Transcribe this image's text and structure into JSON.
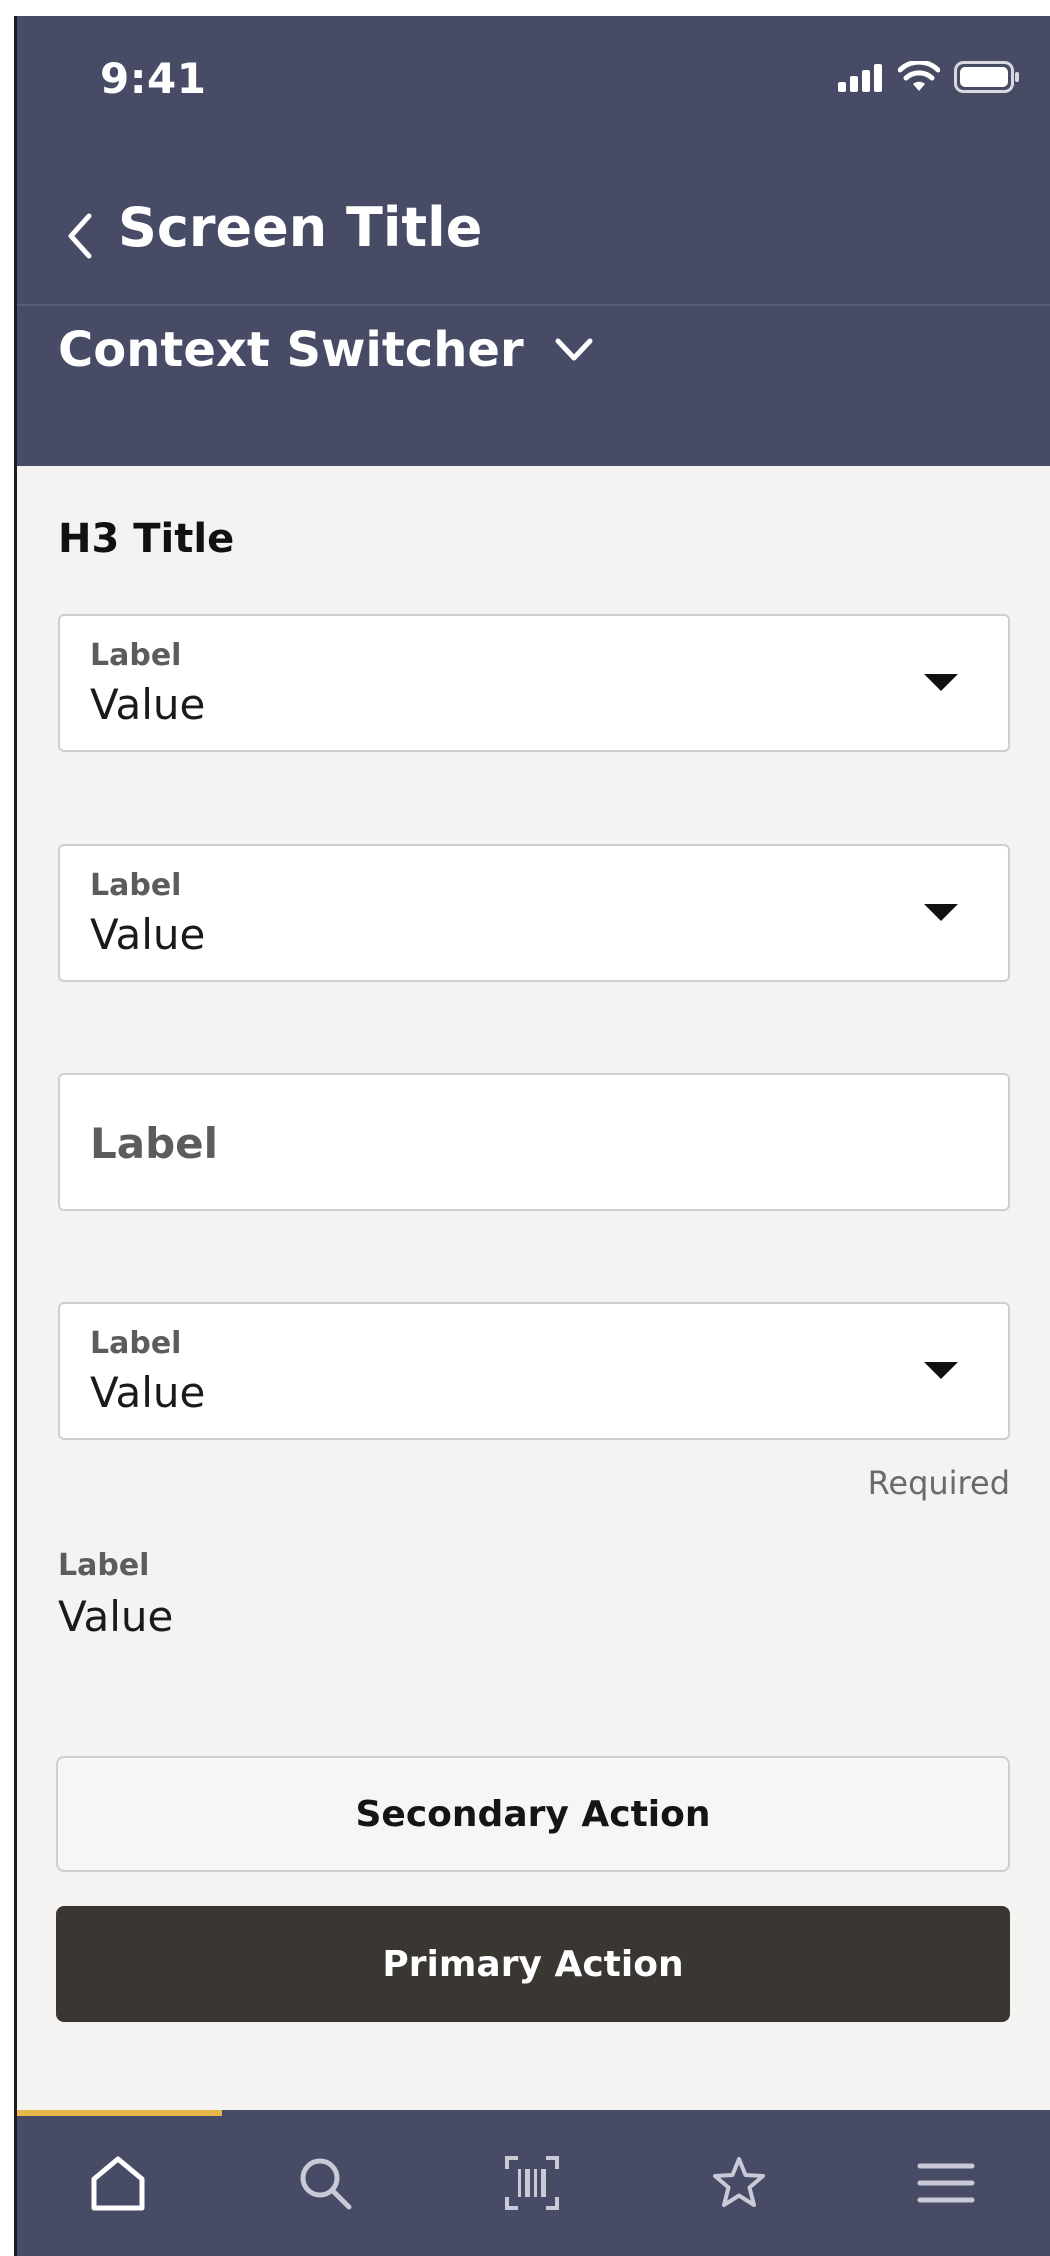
{
  "status_bar": {
    "time": "9:41"
  },
  "header": {
    "title": "Screen Title",
    "context_switcher": "Context Switcher"
  },
  "content": {
    "section_title": "H3 Title",
    "fields": [
      {
        "label": "Label",
        "value": "Value"
      },
      {
        "label": "Label",
        "value": "Value"
      },
      {
        "label": "Label"
      },
      {
        "label": "Label",
        "value": "Value",
        "helper": "Required"
      }
    ],
    "readonly": {
      "label": "Label",
      "value": "Value"
    }
  },
  "actions": {
    "secondary": "Secondary Action",
    "primary": "Primary Action"
  },
  "bottom_nav": {
    "items": [
      "home-icon",
      "search-icon",
      "barcode-scan-icon",
      "star-icon",
      "menu-icon"
    ],
    "active_index": 0
  },
  "colors": {
    "header": "#474b66",
    "primary_button": "#3a3632",
    "active_indicator": "#e6b84a"
  }
}
